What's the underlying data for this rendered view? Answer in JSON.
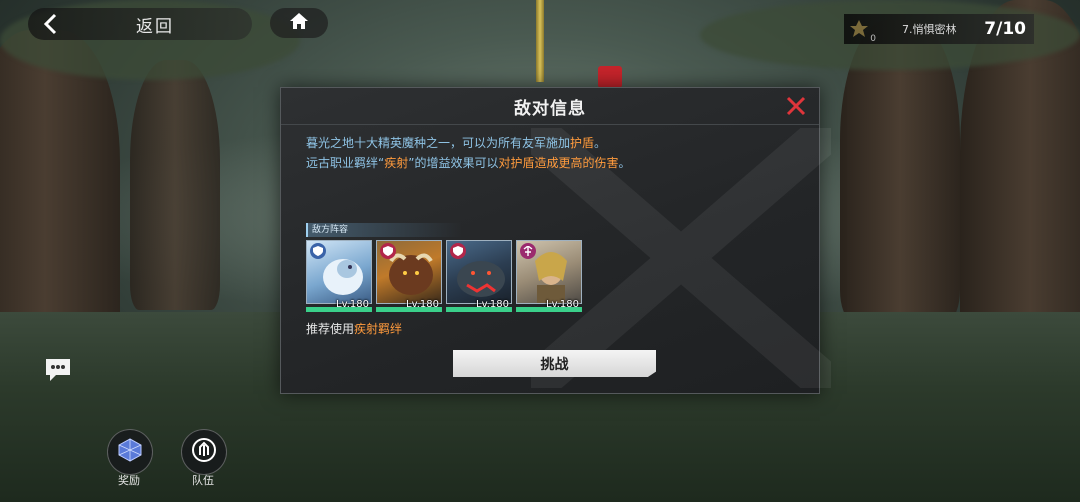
{
  "topbar": {
    "back_label": "返回",
    "back_icon": "chevron-left-icon",
    "home_icon": "home-icon"
  },
  "stage": {
    "emblem_count": "0",
    "name": "7.悄惧密林",
    "progress": "7/10"
  },
  "dialog": {
    "title": "敌对信息",
    "desc_line1_a": "暮光之地十大精英魔种之一，可以为所有友军施加",
    "desc_line1_hl": "护盾",
    "desc_line1_b": "。",
    "desc_line2_a": "远古职业羁绊“",
    "desc_line2_hl1": "疾射",
    "desc_line2_b": "”的增益效果可以",
    "desc_line2_hl2": "对护盾造成更高的伤害",
    "desc_line2_c": "。",
    "lineup_title": "敌方阵容",
    "heroes": [
      {
        "level": "Lv.180",
        "hp": 1.0,
        "badge_color": "#3a63a8",
        "theme": "ice"
      },
      {
        "level": "Lv.180",
        "hp": 1.0,
        "badge_color": "#b2264a",
        "theme": "orc"
      },
      {
        "level": "Lv.180",
        "hp": 1.0,
        "badge_color": "#b2264a",
        "theme": "beast"
      },
      {
        "level": "Lv.180",
        "hp": 1.0,
        "badge_color": "#9b2a6e",
        "theme": "hero"
      }
    ],
    "recommend_a": "推荐使用",
    "recommend_hl": "疾射羁绊",
    "challenge_label": "挑战"
  },
  "bottom": {
    "reward_label": "奖励",
    "team_label": "队伍"
  },
  "colors": {
    "accent_blue": "#8fc4e6",
    "highlight_orange": "#ff9b3d",
    "hp_green": "#3ad08a",
    "close_red": "#e0353b"
  }
}
